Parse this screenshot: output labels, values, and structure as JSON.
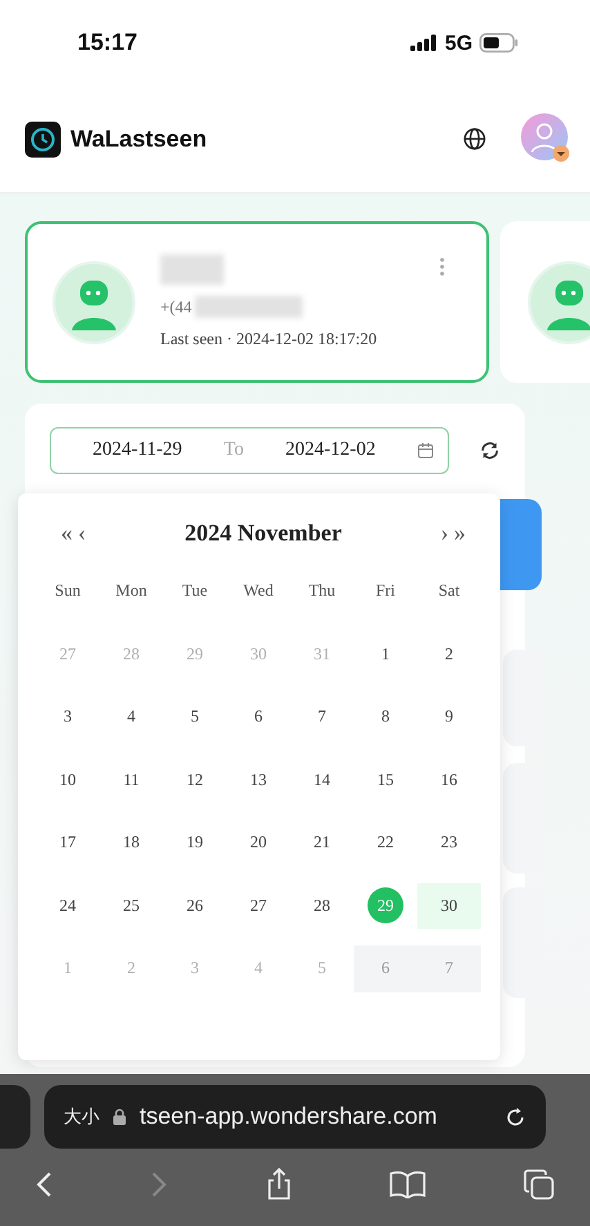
{
  "status_bar": {
    "time": "15:17",
    "network": "5G"
  },
  "header": {
    "app_name": "WaLastseen"
  },
  "contacts": [
    {
      "phone": "+(44",
      "last_seen": "Last seen · 2024-12-02 18:17:20",
      "selected": true
    },
    {
      "selected": false
    }
  ],
  "date_range": {
    "start": "2024-11-29",
    "separator": "To",
    "end": "2024-12-02"
  },
  "calendar": {
    "prev_year": "«",
    "prev_month": "‹",
    "title": "2024 November",
    "next_month": "›",
    "next_year": "»",
    "weekdays": [
      "Sun",
      "Mon",
      "Tue",
      "Wed",
      "Thu",
      "Fri",
      "Sat"
    ],
    "weeks": [
      [
        {
          "label": "27",
          "kind": "outside"
        },
        {
          "label": "28",
          "kind": "outside"
        },
        {
          "label": "29",
          "kind": "outside"
        },
        {
          "label": "30",
          "kind": "outside"
        },
        {
          "label": "31",
          "kind": "outside"
        },
        {
          "label": "1",
          "kind": "day"
        },
        {
          "label": "2",
          "kind": "day"
        }
      ],
      [
        {
          "label": "3",
          "kind": "day"
        },
        {
          "label": "4",
          "kind": "day"
        },
        {
          "label": "5",
          "kind": "day"
        },
        {
          "label": "6",
          "kind": "day"
        },
        {
          "label": "7",
          "kind": "day"
        },
        {
          "label": "8",
          "kind": "day"
        },
        {
          "label": "9",
          "kind": "day"
        }
      ],
      [
        {
          "label": "10",
          "kind": "day"
        },
        {
          "label": "11",
          "kind": "day"
        },
        {
          "label": "12",
          "kind": "day"
        },
        {
          "label": "13",
          "kind": "day"
        },
        {
          "label": "14",
          "kind": "day"
        },
        {
          "label": "15",
          "kind": "day"
        },
        {
          "label": "16",
          "kind": "day"
        }
      ],
      [
        {
          "label": "17",
          "kind": "day"
        },
        {
          "label": "18",
          "kind": "day"
        },
        {
          "label": "19",
          "kind": "day"
        },
        {
          "label": "20",
          "kind": "day"
        },
        {
          "label": "21",
          "kind": "day"
        },
        {
          "label": "22",
          "kind": "day"
        },
        {
          "label": "23",
          "kind": "day"
        }
      ],
      [
        {
          "label": "24",
          "kind": "day"
        },
        {
          "label": "25",
          "kind": "day"
        },
        {
          "label": "26",
          "kind": "day"
        },
        {
          "label": "27",
          "kind": "day"
        },
        {
          "label": "28",
          "kind": "day"
        },
        {
          "label": "29",
          "kind": "start"
        },
        {
          "label": "30",
          "kind": "range"
        }
      ],
      [
        {
          "label": "1",
          "kind": "outside"
        },
        {
          "label": "2",
          "kind": "outside"
        },
        {
          "label": "3",
          "kind": "outside"
        },
        {
          "label": "4",
          "kind": "outside"
        },
        {
          "label": "5",
          "kind": "outside"
        },
        {
          "label": "6",
          "kind": "shaded"
        },
        {
          "label": "7",
          "kind": "shaded"
        }
      ]
    ]
  },
  "browser": {
    "text_size": "大小",
    "url": "tseen-app.wondershare.com"
  }
}
